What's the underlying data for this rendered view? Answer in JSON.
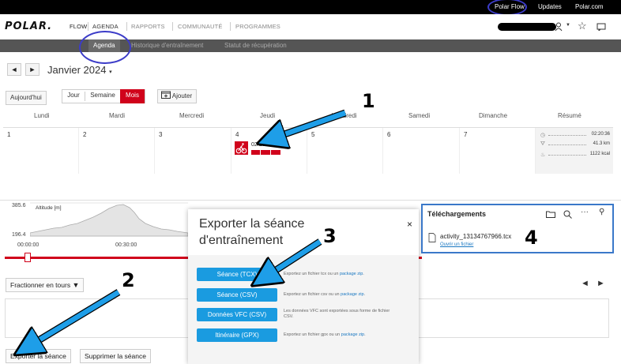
{
  "topbar": {
    "links": [
      "Polar Flow",
      "Updates",
      "Polar.com"
    ]
  },
  "nav": {
    "logo": "POLAR.",
    "flow": "FLOW",
    "items": [
      "AGENDA",
      "RAPPORTS",
      "COMMUNAUTÉ",
      "PROGRAMMES"
    ],
    "icons": [
      "user-icon",
      "chevron-down-icon",
      "star-icon",
      "chat-icon"
    ]
  },
  "subnav": {
    "items": [
      "Agenda",
      "Historique d'entraînement",
      "Statut de récupération"
    ]
  },
  "calendar": {
    "prev": "◄",
    "next": "►",
    "month": "Janvier 2024",
    "today_button": "Aujourd'hui",
    "view_day": "Jour",
    "view_week": "Semaine",
    "view_month": "Mois",
    "add_button": "Ajouter",
    "days": [
      "Lundi",
      "Mardi",
      "Mercredi",
      "Jeudi",
      "Vendredi",
      "Samedi",
      "Dimanche"
    ],
    "summary_label": "Résumé",
    "dates": [
      "1",
      "2",
      "3",
      "4",
      "5",
      "6",
      "7"
    ],
    "session_time": "02:20:36",
    "summary": {
      "duration": "02:20:36",
      "distance": "41.3 km",
      "calories": "1122 kcal"
    }
  },
  "session": {
    "altitude_label": "Altitude [m]",
    "alt_max": "385.6",
    "alt_min": "196.4",
    "time_ticks": [
      "00:00:00",
      "00:30:00"
    ],
    "laps_button": "Fractionner en tours",
    "export_button": "Exporter la séance",
    "delete_button": "Supprimer la séance"
  },
  "export_modal": {
    "title": "Exporter la séance d'entraînement",
    "close": "×",
    "options": [
      {
        "label": "Séance (TCX)",
        "desc": "Exportez un fichier tcx ou un ",
        "link": "package zip",
        "tail": "."
      },
      {
        "label": "Séance (CSV)",
        "desc": "Exportez un fichier csv ou un ",
        "link": "package zip",
        "tail": "."
      },
      {
        "label": "Données VFC (CSV)",
        "desc": "Les données VFC sont exportées sous forme de fichier CSV.",
        "link": "",
        "tail": ""
      },
      {
        "label": "Itinéraire (GPX)",
        "desc": "Exportez un fichier gpx ou un ",
        "link": "package zip",
        "tail": "."
      }
    ]
  },
  "downloads": {
    "title": "Téléchargements",
    "file": "activity_13134767966.tcx",
    "open": "Ouvrir un fichier"
  },
  "annotations": [
    "1",
    "2",
    "3",
    "4"
  ],
  "colors": {
    "accent_red": "#d0021b",
    "export_blue": "#1a9be0",
    "annotation_blue": "#1e9ee8",
    "highlight_oval": "#3c3cc8"
  }
}
